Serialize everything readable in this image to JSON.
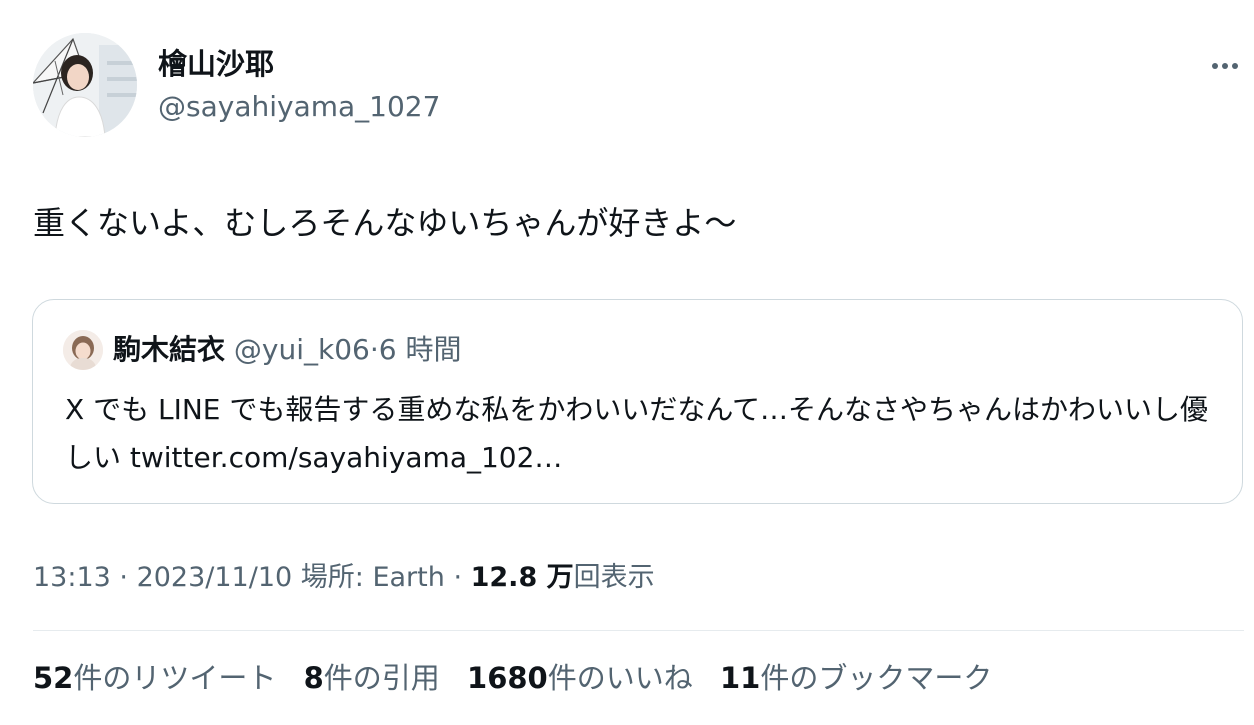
{
  "author": {
    "display_name": "檜山沙耶",
    "handle": "@sayahiyama_1027"
  },
  "tweet": {
    "text": "重くないよ、むしろそんなゆいちゃんが好きよ〜"
  },
  "quoted_tweet": {
    "display_name": "駒木結衣",
    "handle": "@yui_k06",
    "separator": "·",
    "time": "6 時間",
    "text": "X でも LINE でも報告する重めな私をかわいいだなんて…そんなさやちゃんはかわいいし優しい twitter.com/sayahiyama_102…"
  },
  "meta": {
    "time": "13:13",
    "sep1": " · ",
    "date": "2023/11/10",
    "location": " 場所: Earth",
    "sep2": " · ",
    "views_count": "12.8 万",
    "views_label": "回表示"
  },
  "stats": [
    {
      "count": "52",
      "label": "件のリツイート"
    },
    {
      "count": "8",
      "label": "件の引用"
    },
    {
      "count": "1680",
      "label": "件のいいね"
    },
    {
      "count": "11",
      "label": "件のブックマーク"
    }
  ],
  "icons": {
    "more": "more-horizontal-icon"
  },
  "colors": {
    "primary_text": "#0f1419",
    "secondary_text": "#536471",
    "border": "#cfd9de"
  }
}
